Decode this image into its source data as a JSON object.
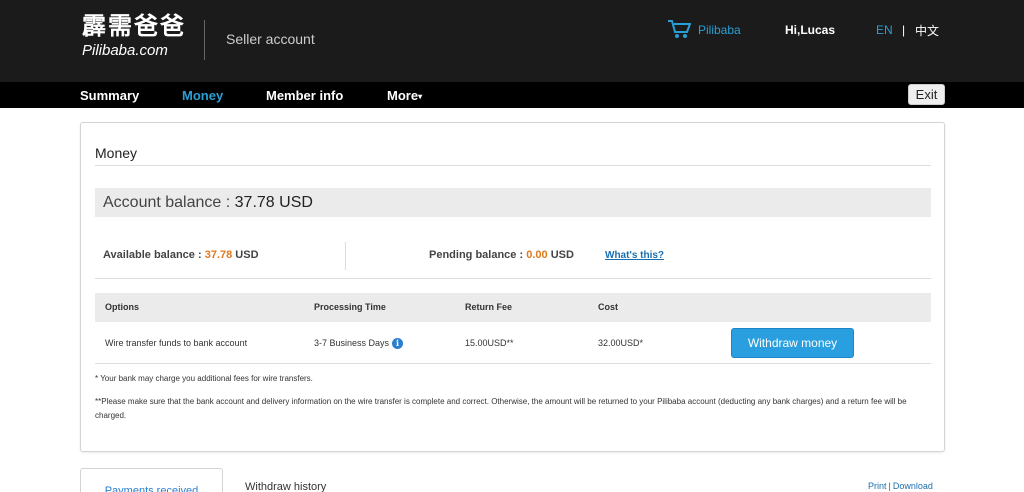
{
  "header": {
    "logo_cn": "霹需爸爸",
    "logo_en": "Pilibaba.com",
    "section": "Seller account",
    "cart_label": "Pilibaba",
    "greeting": "Hi,Lucas",
    "lang_en": "EN",
    "lang_sep": "|",
    "lang_cn": "中文"
  },
  "nav": {
    "items": [
      {
        "label": "Summary"
      },
      {
        "label": "Money"
      },
      {
        "label": "Member info"
      },
      {
        "label": "More"
      }
    ],
    "more_arrow": "▾",
    "exit_label": "Exit"
  },
  "money": {
    "title": "Money",
    "balance_label": "Account balance :",
    "balance_value": "37.78 USD",
    "available_label": "Available balance :",
    "available_value": "37.78",
    "available_unit": "USD",
    "pending_label": "Pending balance :",
    "pending_value": "0.00",
    "pending_unit": "USD",
    "whats_this": "What's this?",
    "table": {
      "headers": [
        "Options",
        "Processing Time",
        "Return Fee",
        "Cost"
      ],
      "row": {
        "option": "Wire transfer funds to bank account",
        "time": "3-7 Business Days",
        "fee": "15.00USD**",
        "cost": "32.00USD*"
      }
    },
    "withdraw_label": "Withdraw money",
    "note1": "* Your bank may charge you additional fees for wire transfers.",
    "note2": "**Please make sure that the bank account and delivery information on the wire transfer is complete and correct. Otherwise, the amount will be returned to your Pilibaba account (deducting any bank charges) and a return fee will be charged."
  },
  "bottom": {
    "tab_payments": "Payments received",
    "withdraw_history": "Withdraw history",
    "print": "Print",
    "sep": "|",
    "download": "Download"
  },
  "colors": {
    "accent": "#2a9fd6",
    "header_bg": "#1b1b1b",
    "orange": "#e07a1f",
    "button": "#2a9fe0"
  },
  "icons": [
    "shopping-cart-icon",
    "info-icon",
    "caret-down-icon"
  ]
}
